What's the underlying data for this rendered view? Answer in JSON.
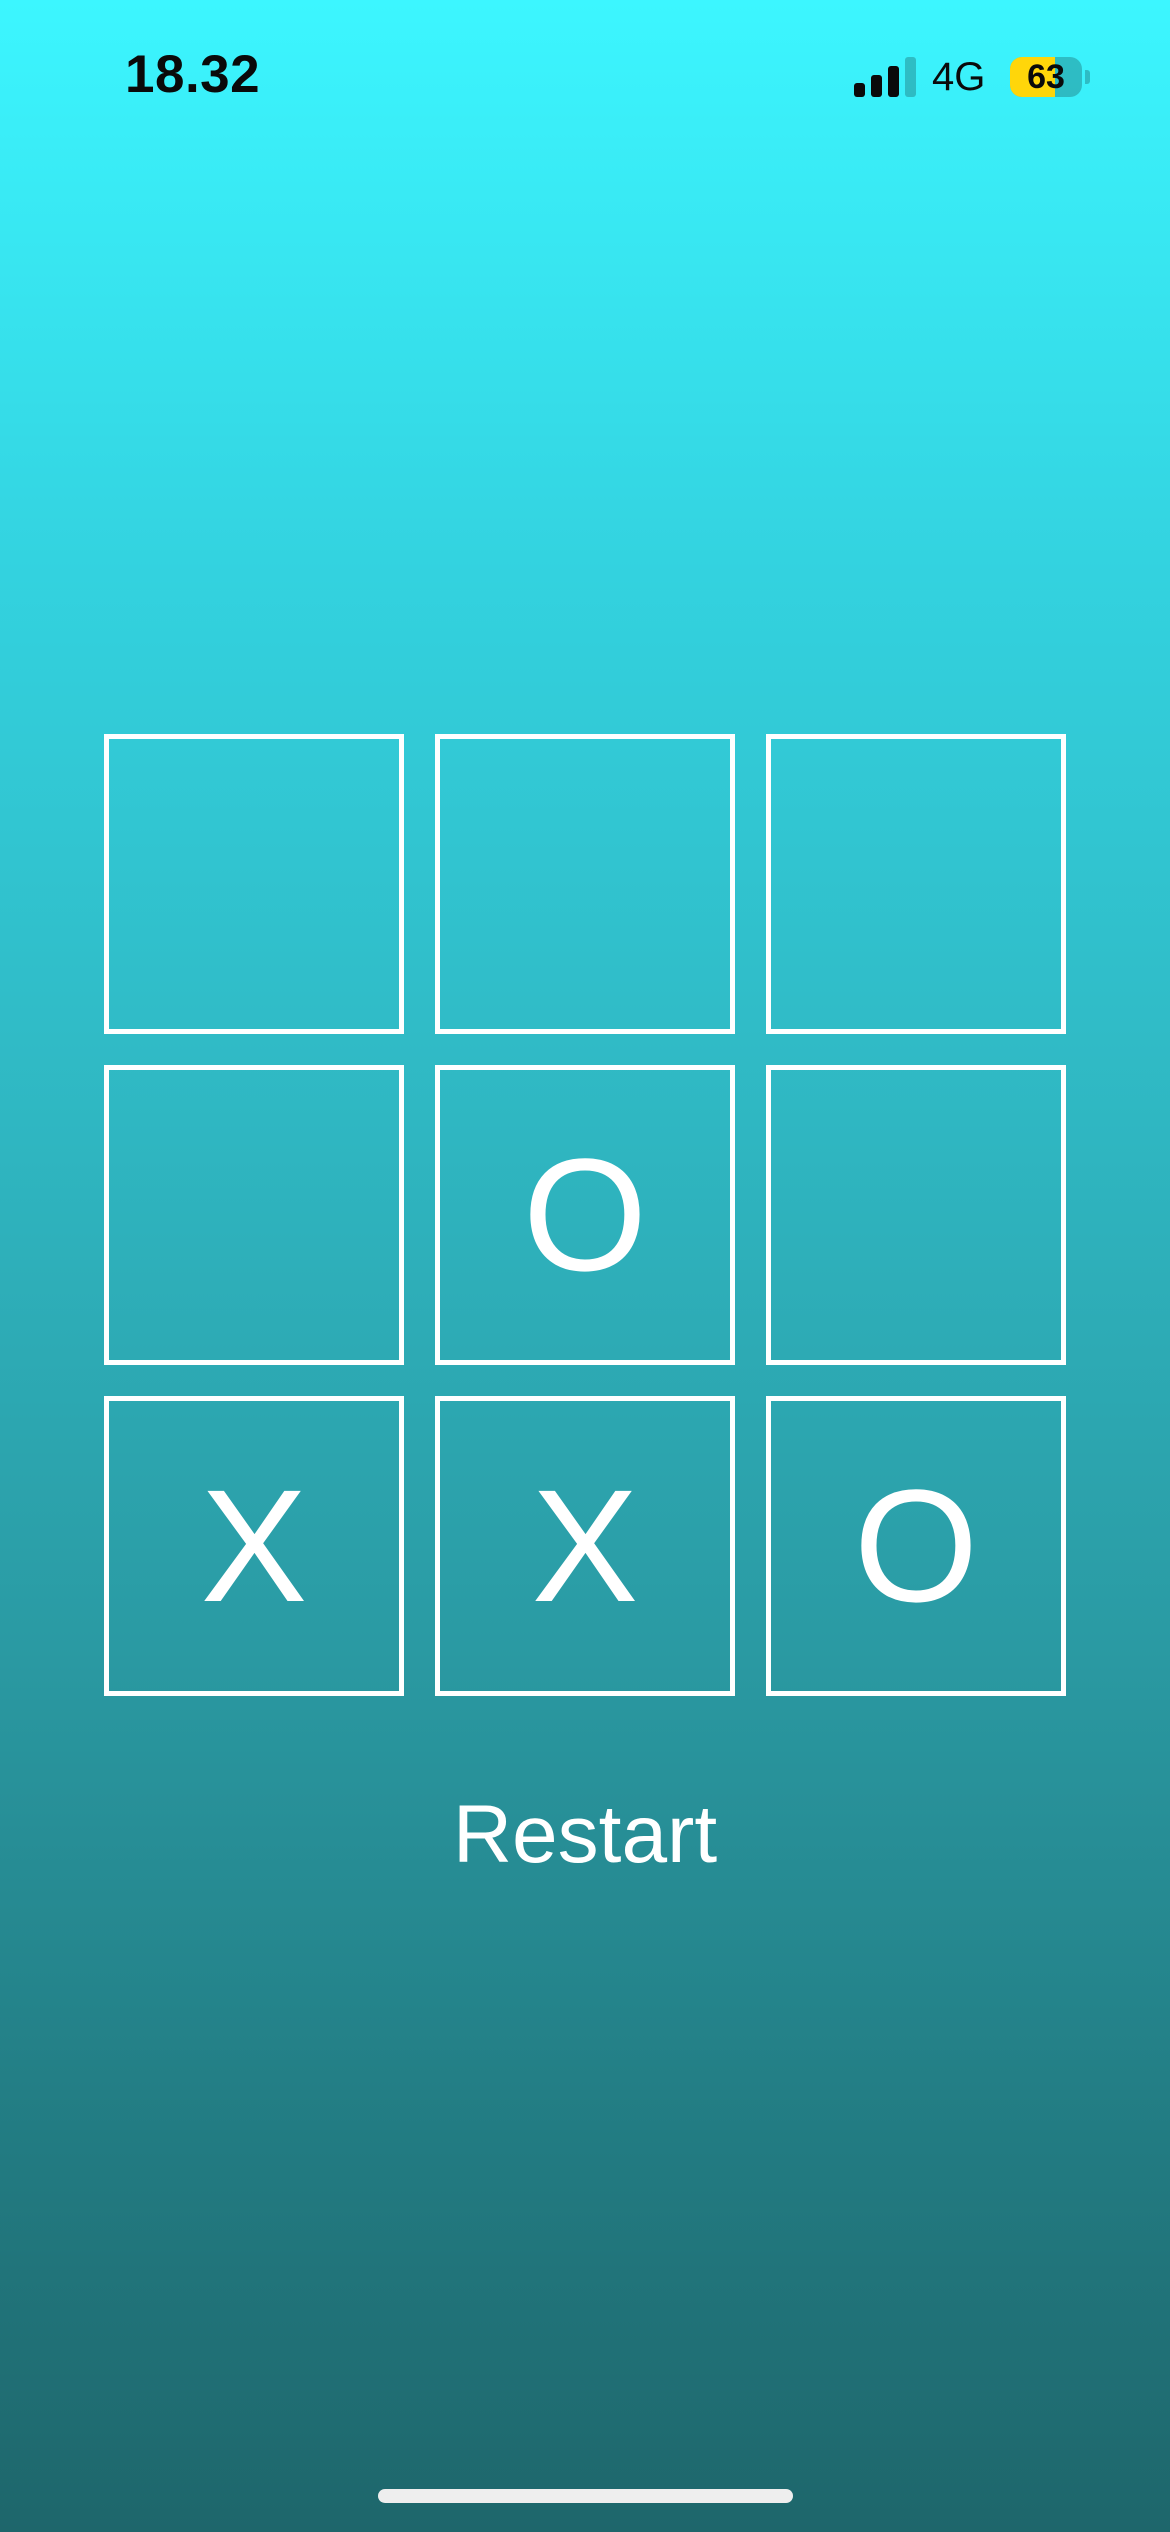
{
  "status_bar": {
    "time": "18.32",
    "network": "4G",
    "battery_level": "63",
    "battery_fraction": 0.63,
    "signal_bars_active": 3,
    "signal_bars_total": 4
  },
  "board": {
    "cells": [
      "",
      "",
      "",
      "",
      "O",
      "",
      "X",
      "X",
      "O"
    ]
  },
  "restart_label": "Restart",
  "colors": {
    "background_top": "#3cf6ff",
    "background_bottom": "#1e666b",
    "board_line": "#ffffff",
    "battery_fill": "#ffd60a"
  }
}
